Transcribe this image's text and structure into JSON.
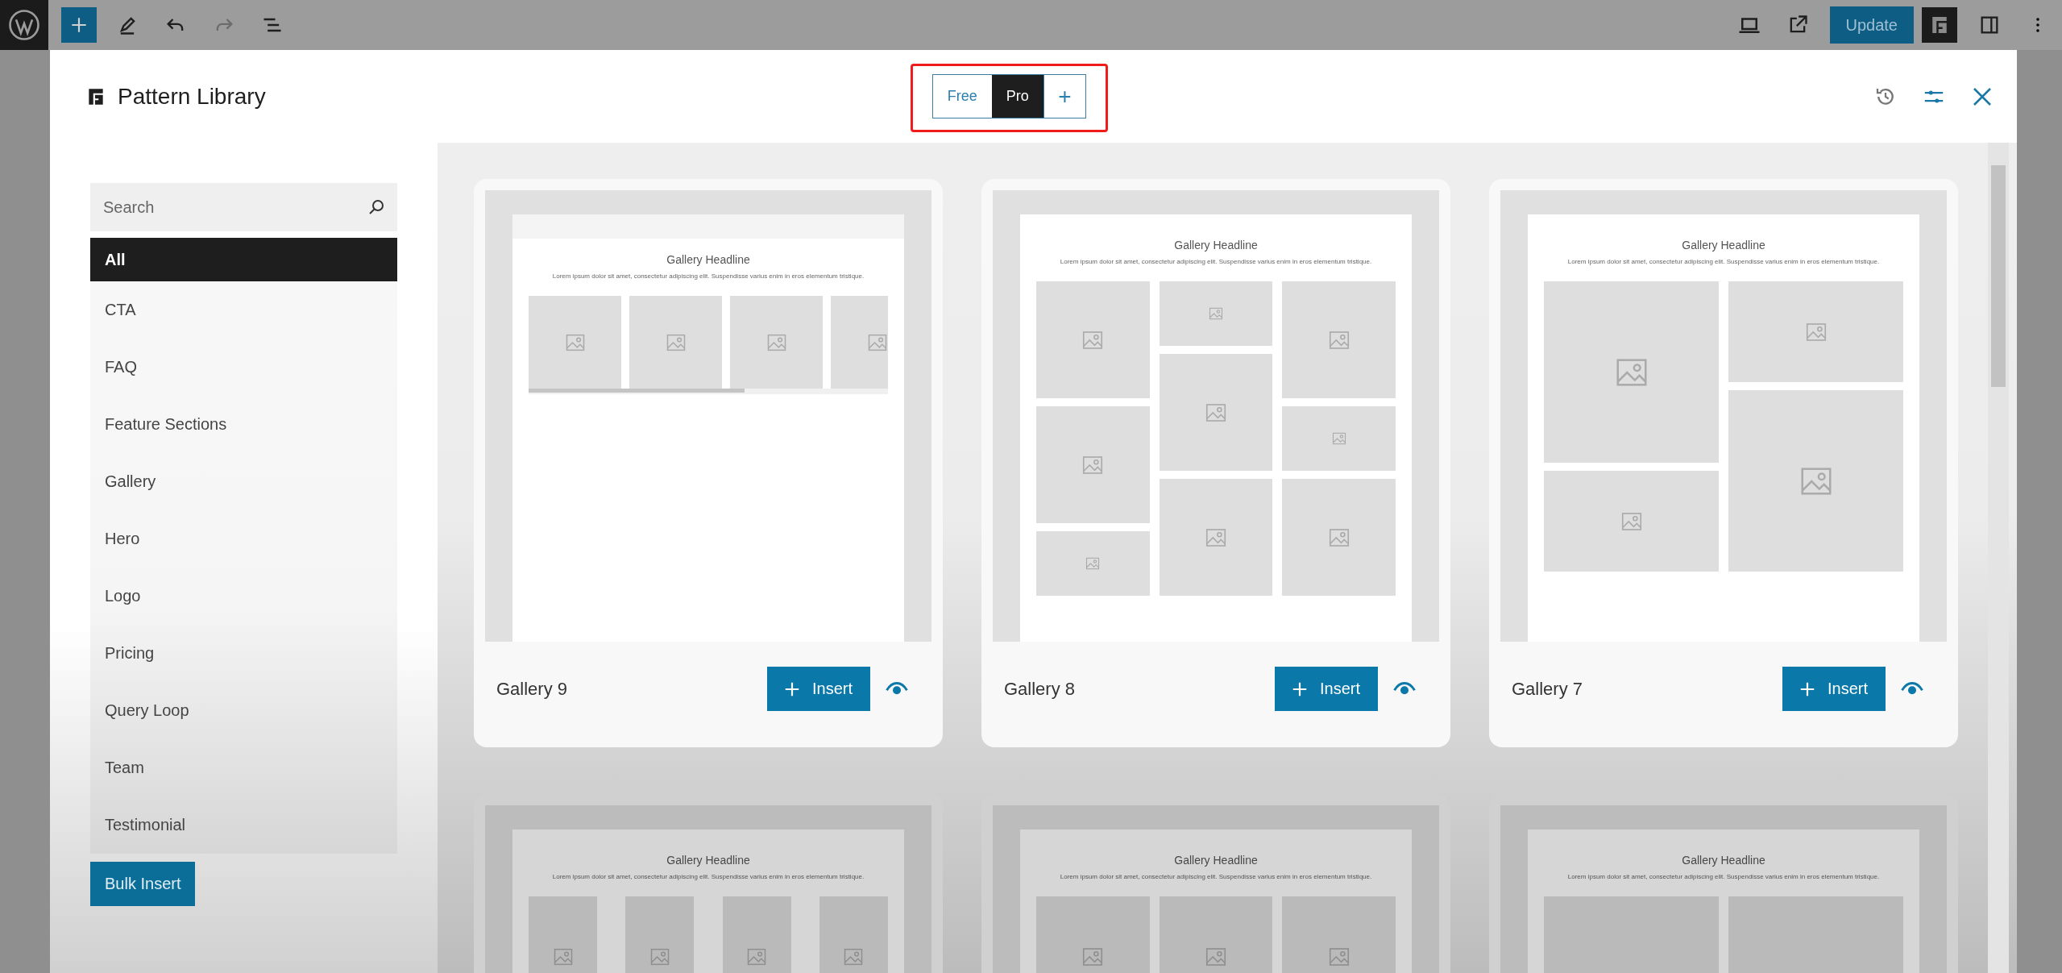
{
  "editor_toolbar": {
    "redo": {
      "disabled": true
    },
    "update_button": "Update"
  },
  "modal": {
    "title": "Pattern Library",
    "plan_switcher": {
      "highlighted": true,
      "tabs": [
        {
          "label": "Free",
          "selected": false
        },
        {
          "label": "Pro",
          "selected": true
        }
      ],
      "add_button": "+"
    },
    "search": {
      "placeholder": "Search"
    },
    "categories": [
      {
        "label": "All",
        "selected": true
      },
      {
        "label": "CTA",
        "selected": false
      },
      {
        "label": "FAQ",
        "selected": false
      },
      {
        "label": "Feature Sections",
        "selected": false
      },
      {
        "label": "Gallery",
        "selected": false
      },
      {
        "label": "Hero",
        "selected": false
      },
      {
        "label": "Logo",
        "selected": false
      },
      {
        "label": "Pricing",
        "selected": false
      },
      {
        "label": "Query Loop",
        "selected": false
      },
      {
        "label": "Team",
        "selected": false
      },
      {
        "label": "Testimonial",
        "selected": false
      }
    ],
    "bulk_insert": "Bulk Insert",
    "patterns": [
      {
        "title": "Gallery 9",
        "kind": "carousel",
        "headline": "Gallery Headline",
        "text": "Lorem ipsum dolor sit amet, consectetur adipiscing elit. Suspendisse varius enim in eros elementum tristique.",
        "insert": "Insert"
      },
      {
        "title": "Gallery 8",
        "kind": "masonry-3",
        "headline": "Gallery Headline",
        "text": "Lorem ipsum dolor sit amet, consectetur adipiscing elit. Suspendisse varius enim in eros elementum tristique.",
        "insert": "Insert"
      },
      {
        "title": "Gallery 7",
        "kind": "masonry-2",
        "headline": "Gallery Headline",
        "text": "Lorem ipsum dolor sit amet, consectetur adipiscing elit. Suspendisse varius enim in eros elementum tristique.",
        "insert": "Insert"
      },
      {
        "kind": "grid-4",
        "headline": "Gallery Headline",
        "text": "Lorem ipsum dolor sit amet, consectetur adipiscing elit. Suspendisse varius enim in eros elementum tristique."
      },
      {
        "kind": "grid-3",
        "headline": "Gallery Headline",
        "text": "Lorem ipsum dolor sit amet, consectetur adipiscing elit. Suspendisse varius enim in eros elementum tristique."
      },
      {
        "kind": "grid-2",
        "headline": "Gallery Headline",
        "text": "Lorem ipsum dolor sit amet, consectetur adipiscing elit. Suspendisse varius enim in eros elementum tristique."
      }
    ]
  }
}
